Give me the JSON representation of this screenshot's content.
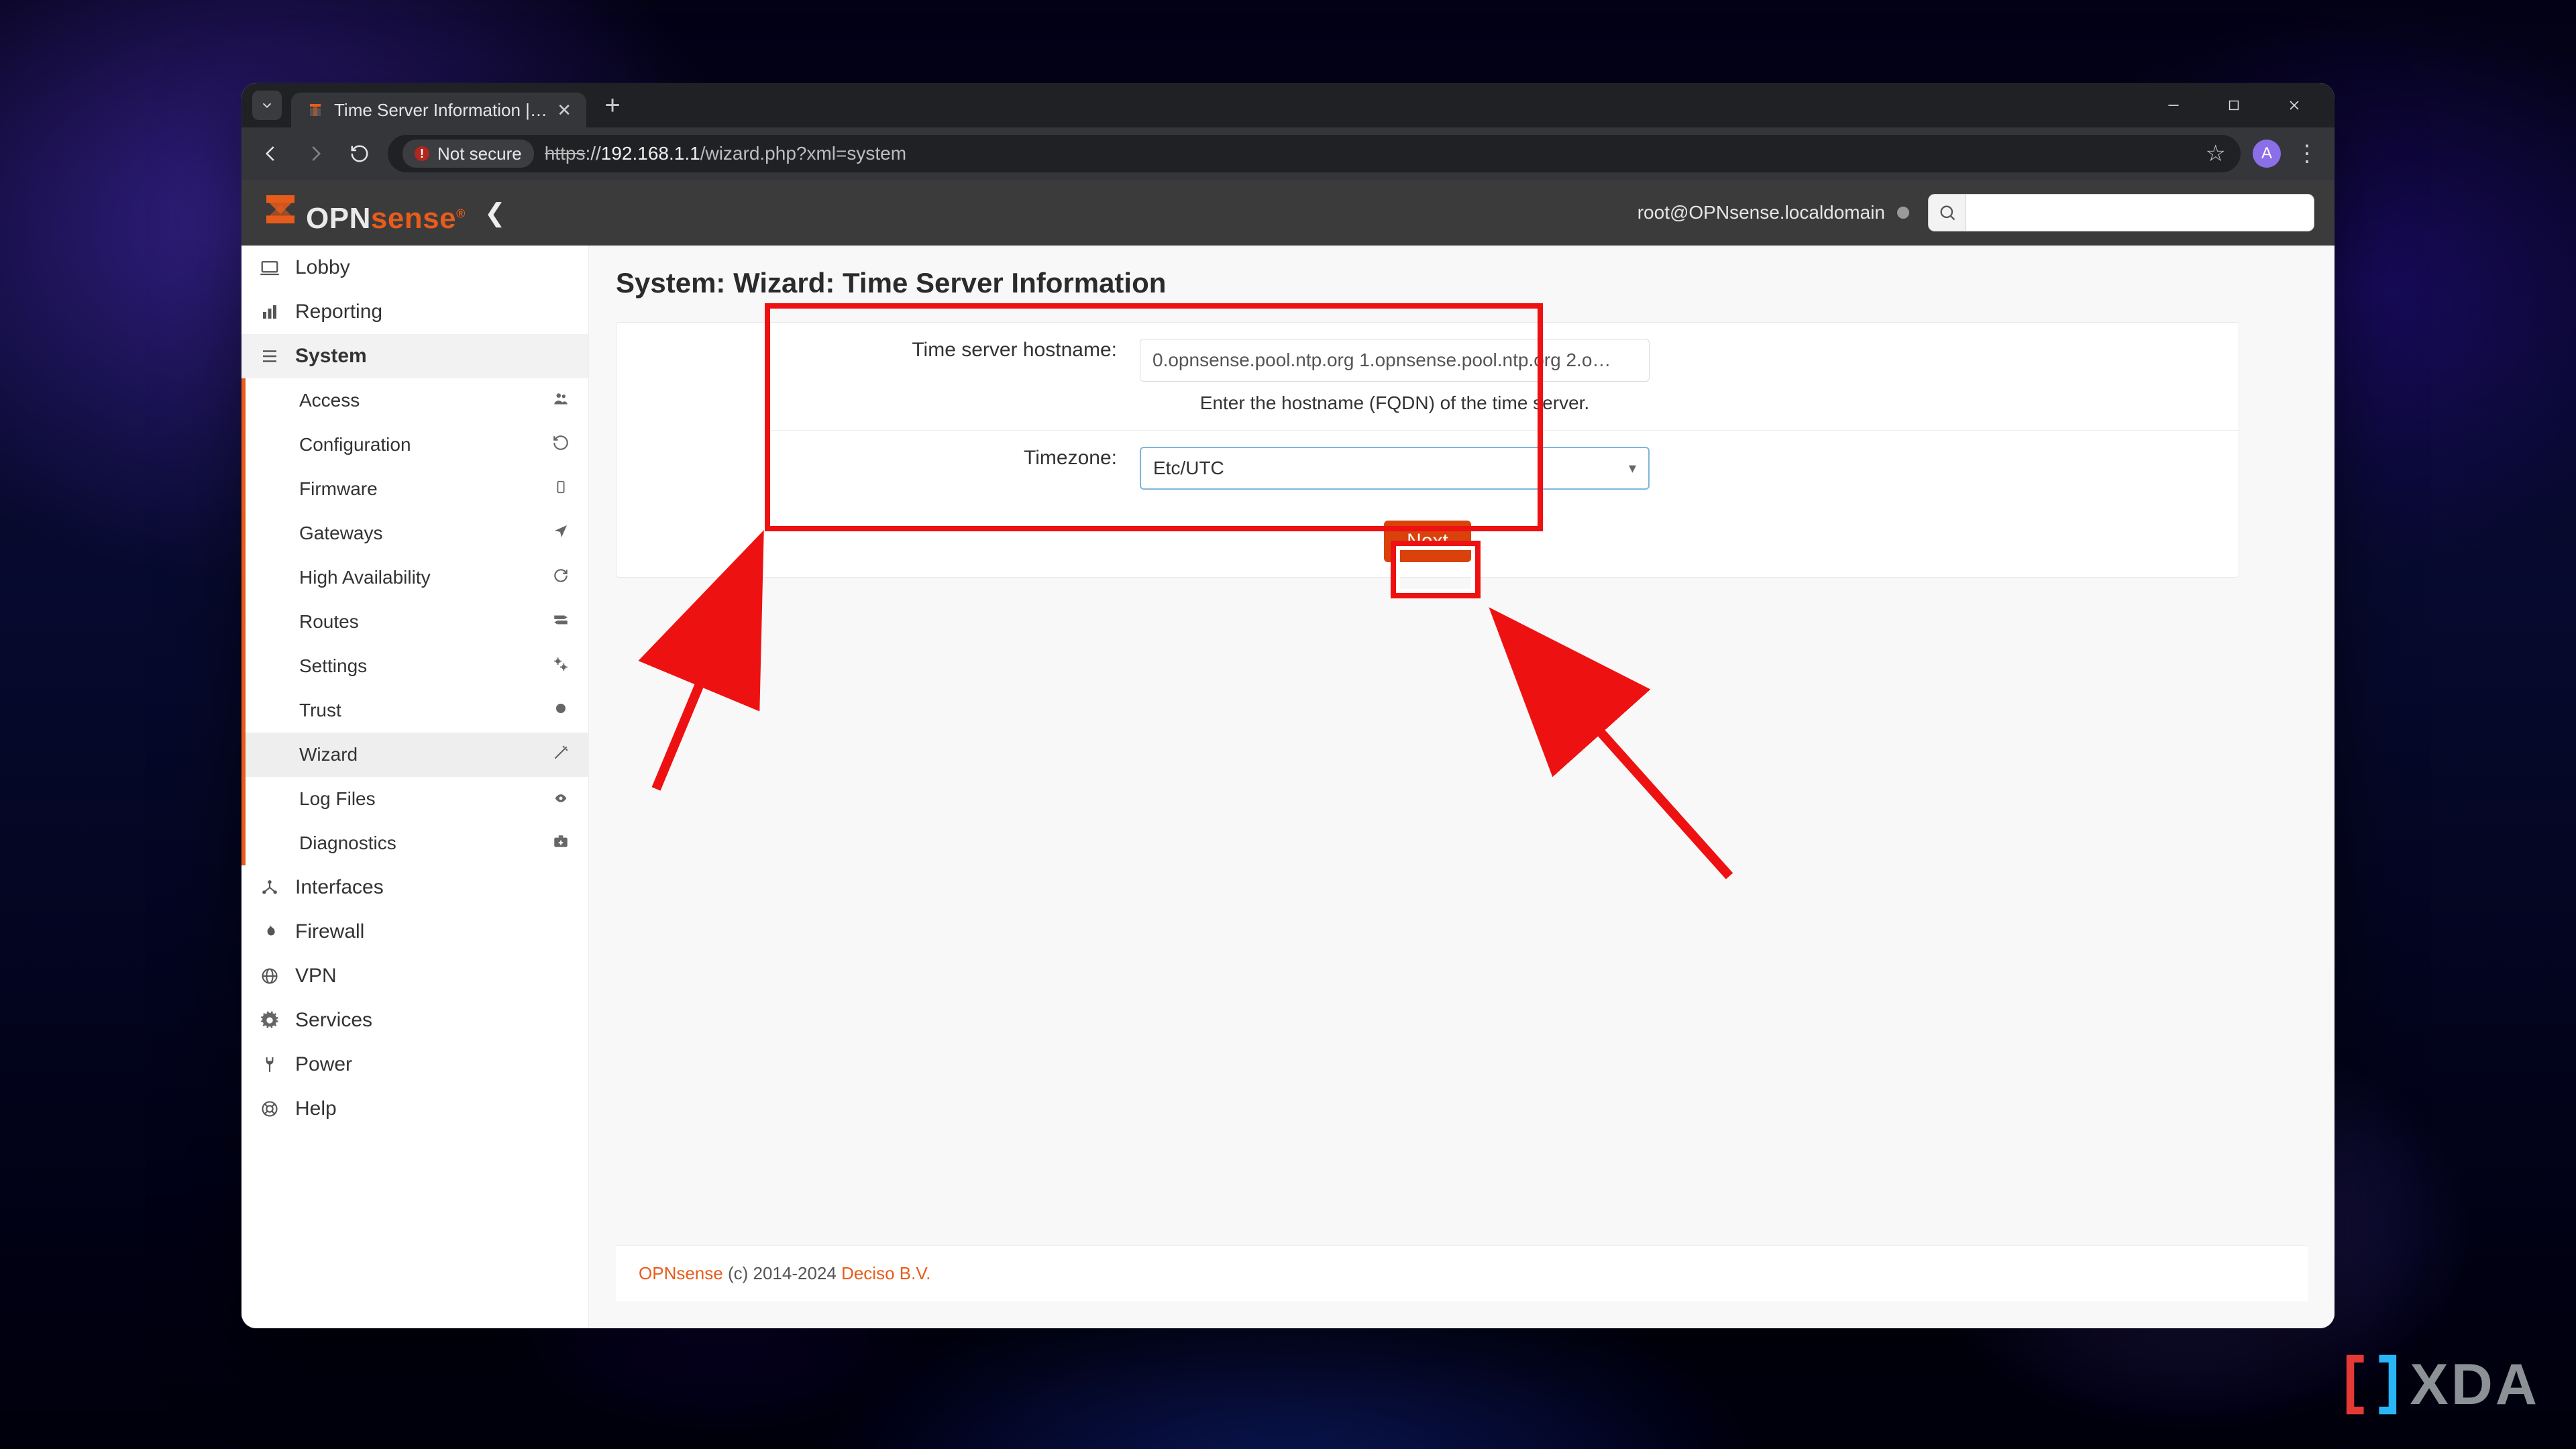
{
  "browser": {
    "tab_title": "Time Server Information | Wiza…",
    "not_secure_label": "Not secure",
    "url_scheme_struck": "https",
    "url_rest": "://",
    "url_host": "192.168.1.1",
    "url_path": "/wizard.php?xml=system",
    "avatar_initial": "A"
  },
  "app_header": {
    "logo_opn": "OPN",
    "logo_sense": "sense",
    "logo_r": "®",
    "user_text": "root@OPNsense.localdomain"
  },
  "sidebar": {
    "lobby": "Lobby",
    "reporting": "Reporting",
    "system": "System",
    "interfaces": "Interfaces",
    "firewall": "Firewall",
    "vpn": "VPN",
    "services": "Services",
    "power": "Power",
    "help": "Help",
    "sub": {
      "access": "Access",
      "configuration": "Configuration",
      "firmware": "Firmware",
      "gateways": "Gateways",
      "high_availability": "High Availability",
      "routes": "Routes",
      "settings": "Settings",
      "trust": "Trust",
      "wizard": "Wizard",
      "log_files": "Log Files",
      "diagnostics": "Diagnostics"
    }
  },
  "page": {
    "title": "System: Wizard: Time Server Information",
    "timeserver_label": "Time server hostname:",
    "timeserver_value": "0.opnsense.pool.ntp.org 1.opnsense.pool.ntp.org 2.o…",
    "timeserver_help": "Enter the hostname (FQDN) of the time server.",
    "timezone_label": "Timezone:",
    "timezone_value": "Etc/UTC",
    "next_label": "Next"
  },
  "footer": {
    "brand": "OPNsense",
    "mid": " (c) 2014-2024 ",
    "company": "Deciso B.V."
  },
  "watermark": {
    "text": "XDA"
  }
}
